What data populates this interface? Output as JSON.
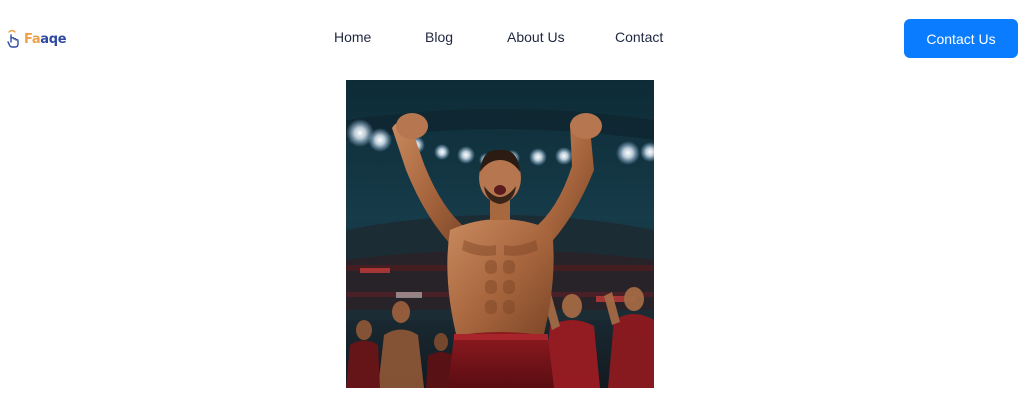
{
  "header": {
    "logo": {
      "text_part1": "Fa",
      "text_part2": "aqe",
      "icon": "hand-pointer-icon",
      "colors": {
        "part1": "#f2a047",
        "part2": "#2f4aa0"
      }
    },
    "nav": [
      {
        "label": "Home"
      },
      {
        "label": "Blog"
      },
      {
        "label": "About Us"
      },
      {
        "label": "Contact"
      }
    ],
    "cta": {
      "label": "Contact Us",
      "color": "#0a7cff"
    }
  },
  "hero": {
    "image": "stadium-celebration-photo"
  }
}
